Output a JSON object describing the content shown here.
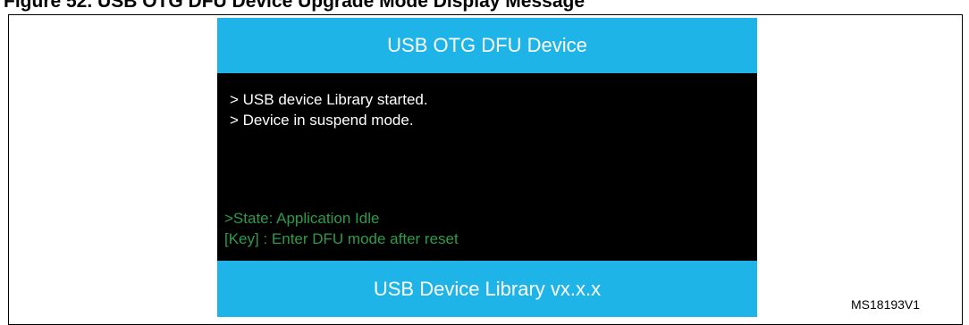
{
  "figure": {
    "caption": "Figure 52. USB OTG DFU Device Upgrade Mode Display Message",
    "reference": "MS18193V1"
  },
  "screen": {
    "header": "USB OTG DFU Device",
    "log_lines": [
      "> USB device Library started.",
      "> Device in suspend mode."
    ],
    "status_lines": [
      ">State: Application Idle",
      "[Key] : Enter DFU mode after reset"
    ],
    "footer": "USB Device Library vx.x.x"
  },
  "colors": {
    "bar_blue": "#1eb4e8",
    "screen_background": "#000000",
    "log_text": "#ffffff",
    "status_text": "#2e9b4a"
  }
}
